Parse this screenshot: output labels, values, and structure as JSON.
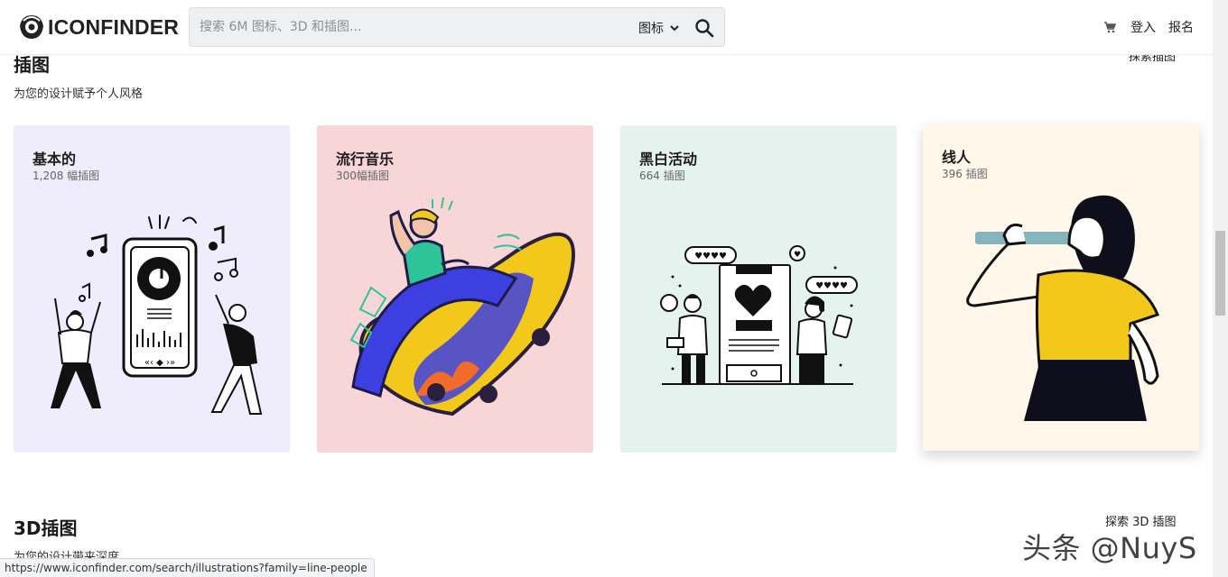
{
  "header": {
    "logo_text": "ICONFINDER",
    "search_placeholder": "搜索 6M 图标、3D 和插图...",
    "search_type": "图标",
    "login": "登入",
    "signup": "报名"
  },
  "illustrations": {
    "title": "插图",
    "subtitle": "为您的设计赋予个人风格",
    "explore": "探索插图",
    "cards": [
      {
        "title": "基本的",
        "count": "1,208 幅插图",
        "bg": "#efedfb"
      },
      {
        "title": "流行音乐",
        "count": "300幅插图",
        "bg": "#f8d5d6"
      },
      {
        "title": "黑白活动",
        "count": "664 插图",
        "bg": "#e5f3ef"
      },
      {
        "title": "线人",
        "count": "396 插图",
        "bg": "#fff8ea"
      }
    ]
  },
  "three_d": {
    "title": "3D插图",
    "subtitle": "为您的设计带来深度",
    "explore": "探索 3D 插图"
  },
  "status_url": "https://www.iconfinder.com/search/illustrations?family=line-people",
  "watermark": "头条 @NuyS",
  "colors": {
    "accent_yellow": "#f2c81b",
    "accent_blue": "#3d3fe0",
    "ink": "#111111"
  }
}
